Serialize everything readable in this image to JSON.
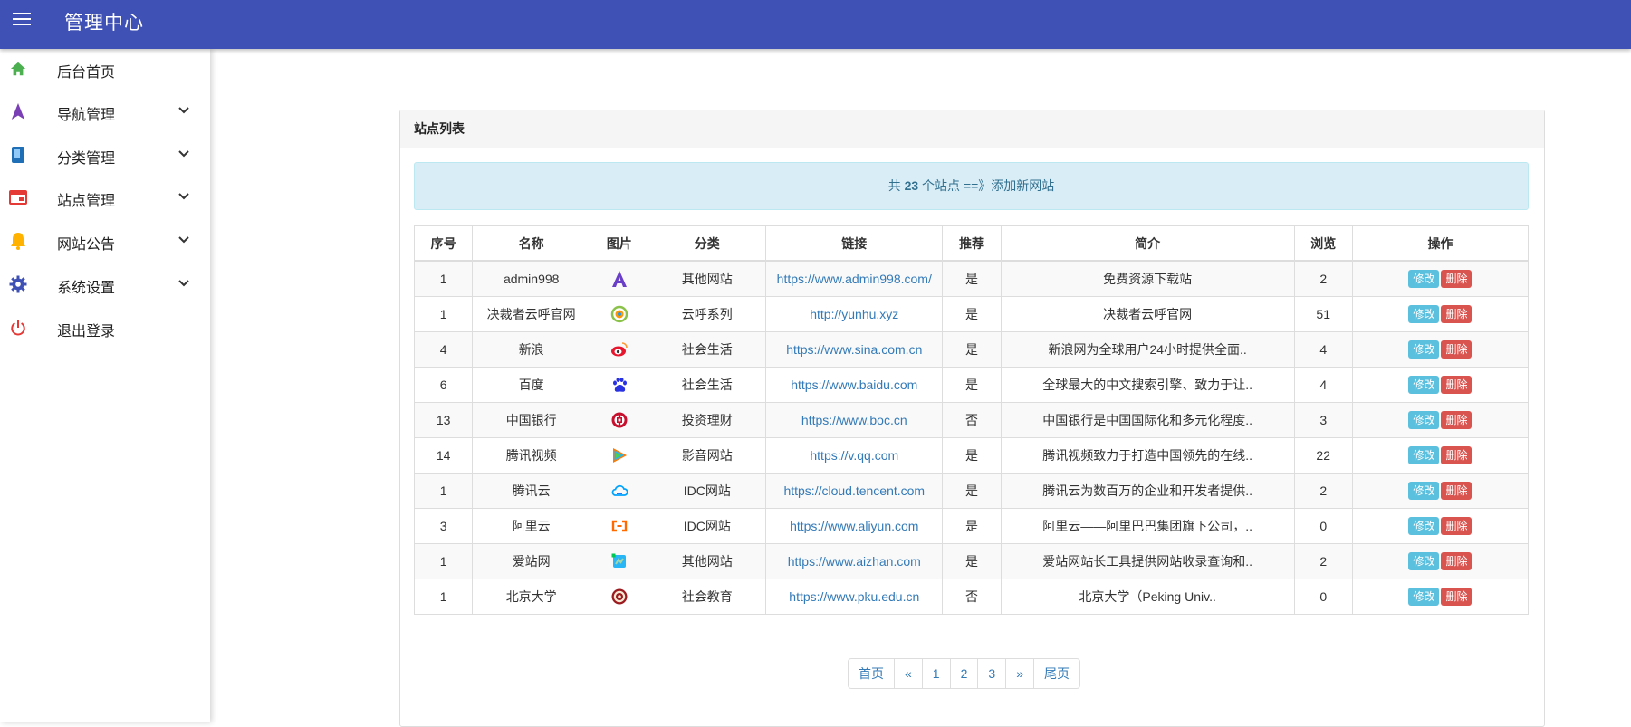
{
  "header": {
    "title": "管理中心"
  },
  "sidebar": {
    "items": [
      {
        "label": "后台首页",
        "icon": "home-icon",
        "color": "#4caf50",
        "has_submenu": false
      },
      {
        "label": "导航管理",
        "icon": "navigation-arrow-icon",
        "color": "#7b3fb5",
        "has_submenu": true
      },
      {
        "label": "分类管理",
        "icon": "book-icon",
        "color": "#1e6fb5",
        "has_submenu": true
      },
      {
        "label": "站点管理",
        "icon": "web-window-icon",
        "color": "#e53935",
        "has_submenu": true
      },
      {
        "label": "网站公告",
        "icon": "bell-icon",
        "color": "#ffb300",
        "has_submenu": true
      },
      {
        "label": "系统设置",
        "icon": "gear-icon",
        "color": "#3f51b5",
        "has_submenu": true
      },
      {
        "label": "退出登录",
        "icon": "power-icon",
        "color": "#e53935",
        "has_submenu": false
      }
    ]
  },
  "panel": {
    "heading": "站点列表",
    "alert": {
      "prefix": "共 ",
      "count": "23",
      "suffix": " 个站点 ",
      "link": "==》添加新网站"
    }
  },
  "table": {
    "columns": [
      "序号",
      "名称",
      "图片",
      "分类",
      "链接",
      "推荐",
      "简介",
      "浏览",
      "操作"
    ],
    "edit_label": "修改",
    "delete_label": "删除",
    "rows": [
      {
        "id": "1",
        "name": "admin998",
        "icon": "admin998-logo-icon",
        "category": "其他网站",
        "url": "https://www.admin998.com/",
        "recommended": "是",
        "desc": "免费资源下载站",
        "views": "2"
      },
      {
        "id": "1",
        "name": "决裁者云呼官网",
        "icon": "yunhu-logo-icon",
        "category": "云呼系列",
        "url": "http://yunhu.xyz",
        "recommended": "是",
        "desc": "决裁者云呼官网",
        "views": "51"
      },
      {
        "id": "4",
        "name": "新浪",
        "icon": "sina-weibo-logo-icon",
        "category": "社会生活",
        "url": "https://www.sina.com.cn",
        "recommended": "是",
        "desc": "新浪网为全球用户24小时提供全面..",
        "views": "4"
      },
      {
        "id": "6",
        "name": "百度",
        "icon": "baidu-paw-logo-icon",
        "category": "社会生活",
        "url": "https://www.baidu.com",
        "recommended": "是",
        "desc": "全球最大的中文搜索引擎、致力于让..",
        "views": "4"
      },
      {
        "id": "13",
        "name": "中国银行",
        "icon": "boc-logo-icon",
        "category": "投资理财",
        "url": "https://www.boc.cn",
        "recommended": "否",
        "desc": "中国银行是中国国际化和多元化程度..",
        "views": "3"
      },
      {
        "id": "14",
        "name": "腾讯视频",
        "icon": "tencent-video-logo-icon",
        "category": "影音网站",
        "url": "https://v.qq.com",
        "recommended": "是",
        "desc": "腾讯视频致力于打造中国领先的在线..",
        "views": "22"
      },
      {
        "id": "1",
        "name": "腾讯云",
        "icon": "tencent-cloud-logo-icon",
        "category": "IDC网站",
        "url": "https://cloud.tencent.com",
        "recommended": "是",
        "desc": "腾讯云为数百万的企业和开发者提供..",
        "views": "2"
      },
      {
        "id": "3",
        "name": "阿里云",
        "icon": "aliyun-logo-icon",
        "category": "IDC网站",
        "url": "https://www.aliyun.com",
        "recommended": "是",
        "desc": "阿里云——阿里巴巴集团旗下公司，..",
        "views": "0"
      },
      {
        "id": "1",
        "name": "爱站网",
        "icon": "aizhan-logo-icon",
        "category": "其他网站",
        "url": "https://www.aizhan.com",
        "recommended": "是",
        "desc": "爱站网站长工具提供网站收录查询和..",
        "views": "2"
      },
      {
        "id": "1",
        "name": "北京大学",
        "icon": "pku-logo-icon",
        "category": "社会教育",
        "url": "https://www.pku.edu.cn",
        "recommended": "否",
        "desc": "北京大学（Peking Univ..",
        "views": "0"
      }
    ]
  },
  "pagination": {
    "first": "首页",
    "prev": "«",
    "pages": [
      "1",
      "2",
      "3"
    ],
    "next": "»",
    "last": "尾页"
  },
  "colors": {
    "topbar": "#3f51b5",
    "link": "#337ab7",
    "recommended_yes": "#f0ad4e",
    "edit_button": "#5bc0de",
    "delete_button": "#d9534f",
    "alert_bg": "#d9edf7"
  }
}
